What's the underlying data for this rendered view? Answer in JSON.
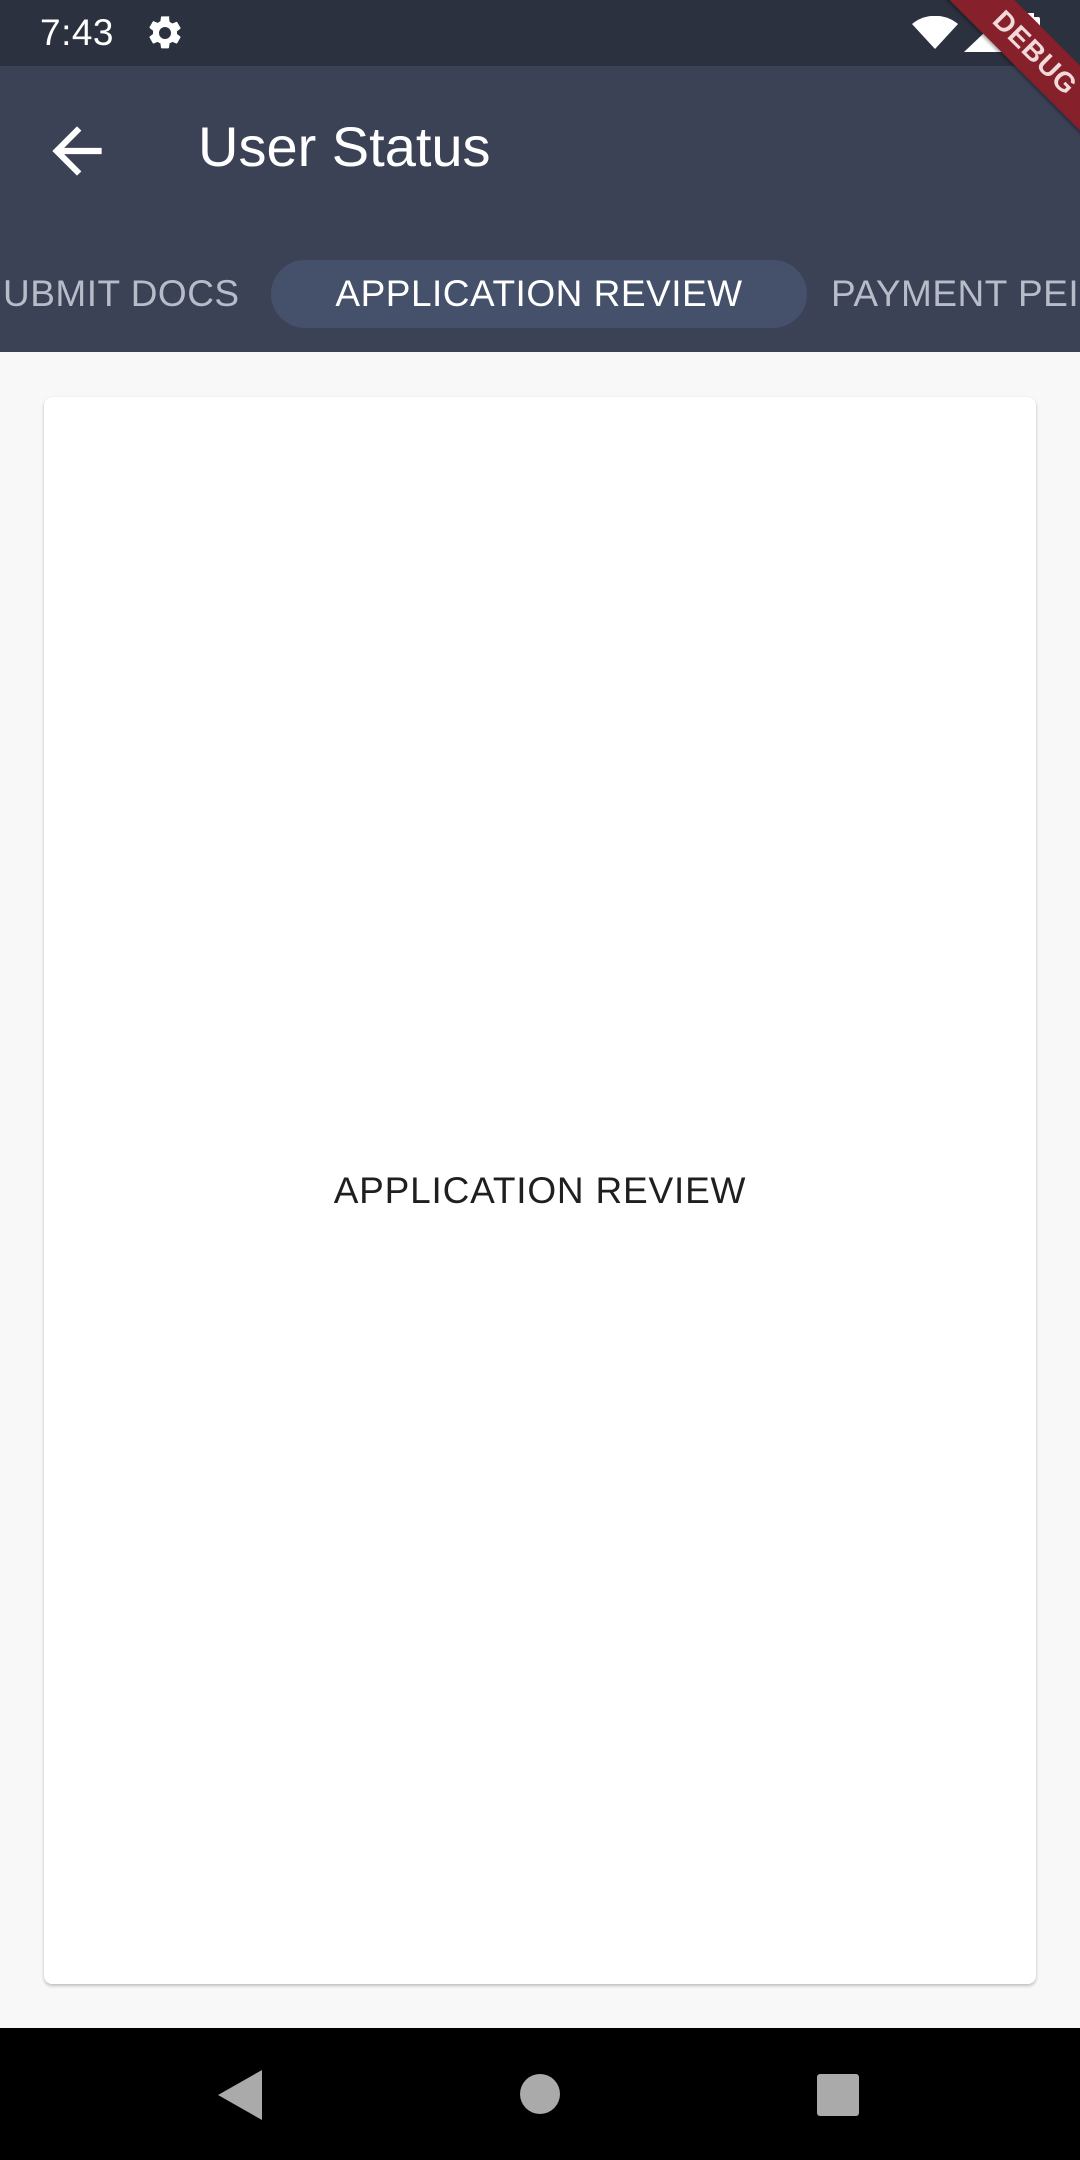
{
  "status_bar": {
    "time": "7:43",
    "icons": [
      "gear-icon",
      "wifi-icon",
      "signal-icon",
      "battery-icon"
    ]
  },
  "app_bar": {
    "title": "User Status",
    "back_icon": "arrow-left-icon",
    "background_color": "#3b4256"
  },
  "tabs": [
    {
      "label": "UBMIT DOCS",
      "selected": false
    },
    {
      "label": "APPLICATION REVIEW",
      "selected": true
    },
    {
      "label": "PAYMENT PEI",
      "selected": false
    }
  ],
  "content": {
    "text": "APPLICATION REVIEW"
  },
  "debug_banner": {
    "label": "DEBUG",
    "color": "#86202a"
  },
  "nav_bar": {
    "icons": [
      "nav-back-icon",
      "nav-home-icon",
      "nav-recents-icon"
    ]
  }
}
